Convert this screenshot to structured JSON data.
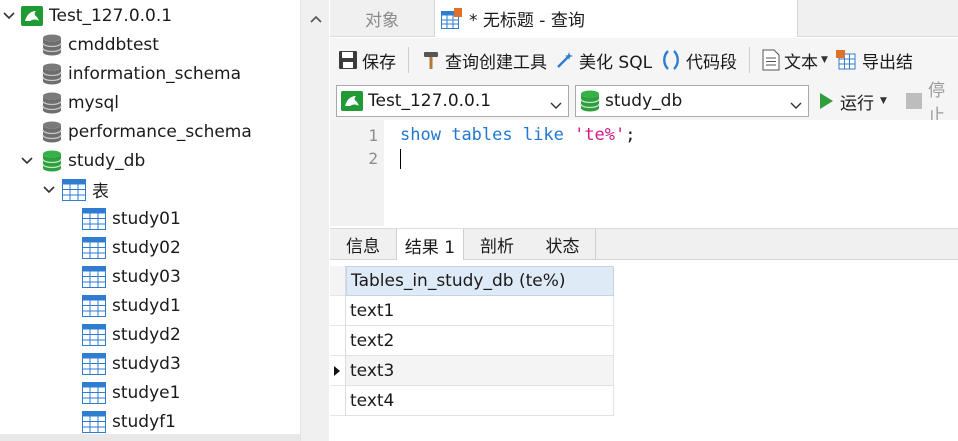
{
  "tree": {
    "connection": "Test_127.0.0.1",
    "databases": [
      "cmddbtest",
      "information_schema",
      "mysql",
      "performance_schema",
      "study_db"
    ],
    "tables_folder": "表",
    "tables": [
      "study01",
      "study02",
      "study03",
      "studyd1",
      "studyd2",
      "studyd3",
      "studye1",
      "studyf1"
    ]
  },
  "tabs": {
    "objects": "对象",
    "query": "* 无标题 - 查询"
  },
  "toolbar": {
    "save": "保存",
    "query_builder": "查询创建工具",
    "beautify": "美化 SQL",
    "snippet": "代码段",
    "text": "文本",
    "export": "导出结"
  },
  "selectors": {
    "connection": "Test_127.0.0.1",
    "database": "study_db",
    "run": "运行",
    "stop": "停止"
  },
  "editor": {
    "line_numbers": [
      "1",
      "2"
    ],
    "kw1": "show",
    "kw2": "tables",
    "kw3": "like",
    "str": "'te%'",
    "end": ";"
  },
  "result_tabs": {
    "info": "信息",
    "result": "结果 1",
    "profile": "剖析",
    "status": "状态"
  },
  "grid": {
    "column": "Tables_in_study_db (te%)",
    "rows": [
      "text1",
      "text2",
      "text3",
      "text4"
    ]
  },
  "colors": {
    "db_green": "#2e9e3e",
    "mysql_green": "#1f9a35",
    "keyword": "#1f78d1",
    "string": "#d11a86",
    "header_bg": "#dfeaf7"
  }
}
